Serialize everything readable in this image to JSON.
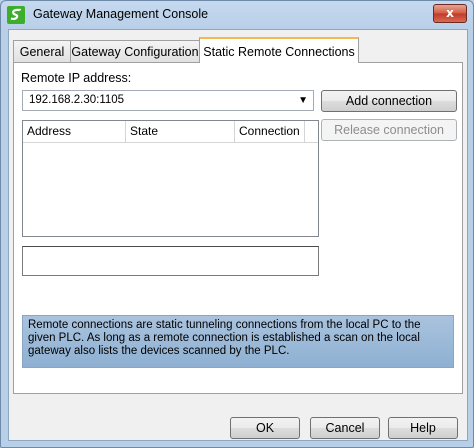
{
  "window": {
    "title": "Gateway Management Console",
    "close_label": "x"
  },
  "tabs": [
    {
      "label": "General",
      "active": false
    },
    {
      "label": "Gateway Configuration",
      "active": false
    },
    {
      "label": "Static Remote Connections",
      "active": true
    }
  ],
  "panel": {
    "remote_ip_label": "Remote IP address:",
    "remote_ip_value": "192.168.2.30:1105",
    "add_connection_label": "Add connection",
    "release_connection_label": "Release connection",
    "columns": [
      "Address",
      "State",
      "Connection"
    ],
    "rows": [],
    "status_text": "",
    "info_text": "Remote connections are static tunneling connections from the local PC to the given PLC. As long as a remote connection is established a scan on the local gateway also lists the devices scanned by the PLC."
  },
  "footer": {
    "ok_label": "OK",
    "cancel_label": "Cancel",
    "help_label": "Help"
  },
  "colors": {
    "active_tab_accent": "#f2b94c",
    "info_background": "#9fbad8",
    "window_frame": "#b9d1ea"
  }
}
